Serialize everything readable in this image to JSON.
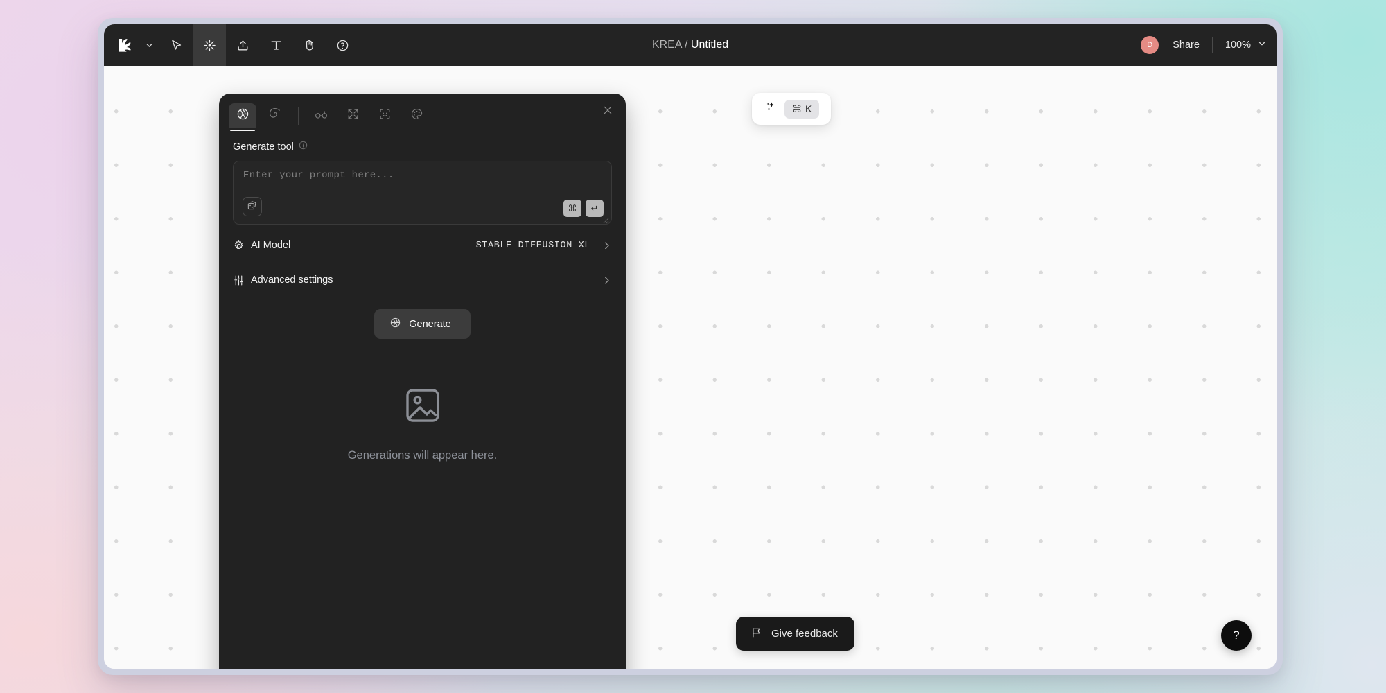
{
  "topbar": {
    "logo_icon": "krea-logo-icon",
    "logo_chevron_icon": "chevron-down-icon",
    "tools": [
      {
        "name": "cursor-tool",
        "icon": "cursor-arrow-icon",
        "active": false
      },
      {
        "name": "generate-tool",
        "icon": "sparkle-burst-icon",
        "active": true
      },
      {
        "name": "upload-tool",
        "icon": "upload-icon",
        "active": false
      },
      {
        "name": "text-tool",
        "icon": "text-t-icon",
        "active": false
      },
      {
        "name": "hand-tool",
        "icon": "hand-icon",
        "active": false
      },
      {
        "name": "help-tool",
        "icon": "question-circle-icon",
        "active": false
      }
    ],
    "title_brand": "KREA",
    "title_separator": " / ",
    "title_document": "Untitled",
    "avatar_initial": "D",
    "avatar_color": "#e58b84",
    "share_label": "Share",
    "zoom_level": "100%",
    "zoom_chevron_icon": "chevron-down-icon"
  },
  "cmdk": {
    "sparkle_icon": "sparkles-icon",
    "modifier": "⌘",
    "key": "K"
  },
  "panel": {
    "tabs": [
      {
        "name": "tab-generate",
        "icon": "aperture-icon",
        "active": true
      },
      {
        "name": "tab-enhance",
        "icon": "spiral-icon",
        "active": false
      },
      {
        "name": "tab-realtime",
        "icon": "glasses-icon",
        "active": false
      },
      {
        "name": "tab-upscale",
        "icon": "expand-arrows-icon",
        "active": false
      },
      {
        "name": "tab-face",
        "icon": "face-scan-icon",
        "active": false
      },
      {
        "name": "tab-style",
        "icon": "palette-icon",
        "active": false
      }
    ],
    "close_icon": "close-icon",
    "tool_title": "Generate tool",
    "tool_info_icon": "info-circle-icon",
    "prompt": {
      "placeholder": "Enter your prompt here...",
      "value": "",
      "dice_icon": "dice-shuffle-icon",
      "key_modifier": "⌘",
      "key_enter": "↵",
      "resize_icon": "resize-grip-icon"
    },
    "settings": [
      {
        "name": "ai-model-row",
        "icon": "gear-icon",
        "label": "AI Model",
        "value": "STABLE DIFFUSION XL",
        "chevron_icon": "chevron-right-icon"
      },
      {
        "name": "advanced-settings-row",
        "icon": "sliders-icon",
        "label": "Advanced settings",
        "value": "",
        "chevron_icon": "chevron-right-icon"
      }
    ],
    "generate_button": {
      "label": "Generate",
      "icon": "aperture-icon"
    },
    "empty_state": {
      "icon": "image-placeholder-icon",
      "text": "Generations will appear here."
    }
  },
  "canvas": {
    "feedback_label": "Give feedback",
    "feedback_icon": "flag-icon",
    "help_label": "?",
    "help_icon": "question-mark-icon"
  }
}
